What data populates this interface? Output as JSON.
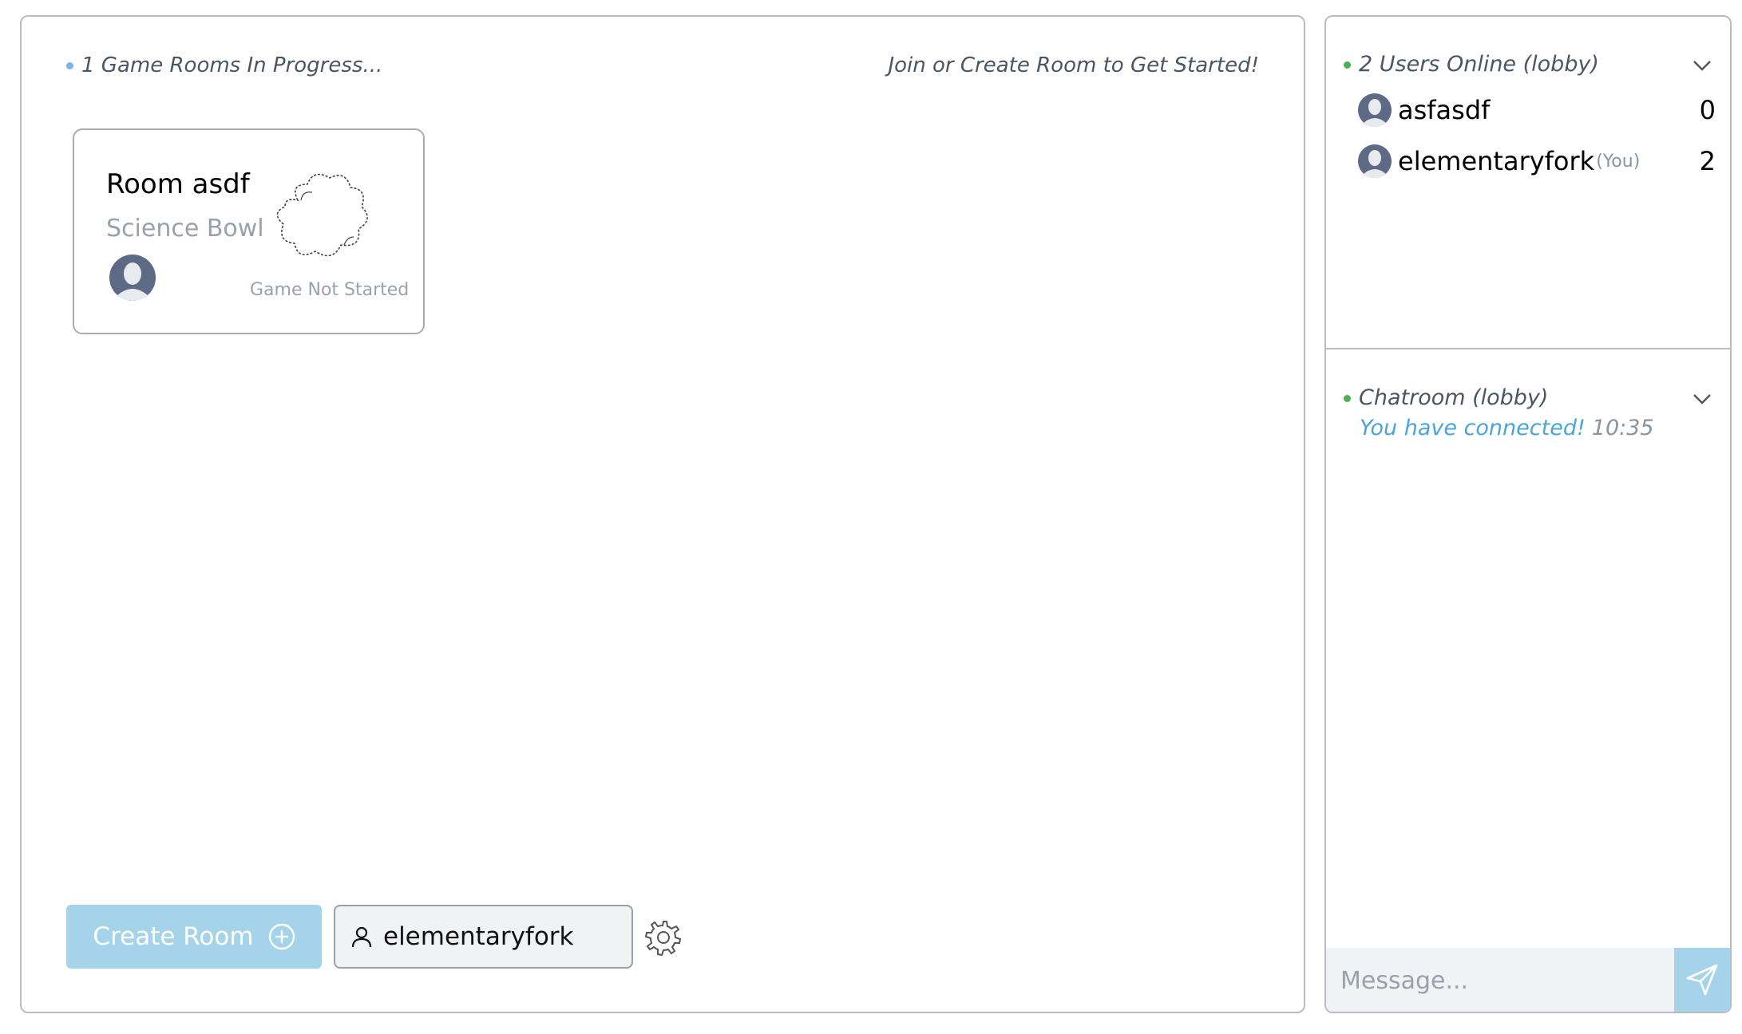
{
  "lobby": {
    "rooms_status": "1 Game Rooms In Progress...",
    "join_hint": "Join or Create Room to Get Started!",
    "status_dot_color": "#7cb4e6",
    "rooms": [
      {
        "name": "Room asdf",
        "category": "Science Bowl",
        "state": "Game Not Started"
      }
    ],
    "create_button_label": "Create Room",
    "username_value": "elementaryfork"
  },
  "users_panel": {
    "heading": "2 Users Online (lobby)",
    "status_dot_color": "#4caf50",
    "users": [
      {
        "name": "asfasdf",
        "you_tag": "",
        "score": "0"
      },
      {
        "name": "elementaryfork",
        "you_tag": "(You)",
        "score": "2"
      }
    ]
  },
  "chat_panel": {
    "heading": "Chatroom (lobby)",
    "messages": [
      {
        "text": "You have connected!",
        "time": "10:35"
      }
    ],
    "input_placeholder": "Message..."
  },
  "colors": {
    "accent": "#a5d4ea",
    "connected_text": "#4aa6d6",
    "border": "#b9bcc3"
  }
}
